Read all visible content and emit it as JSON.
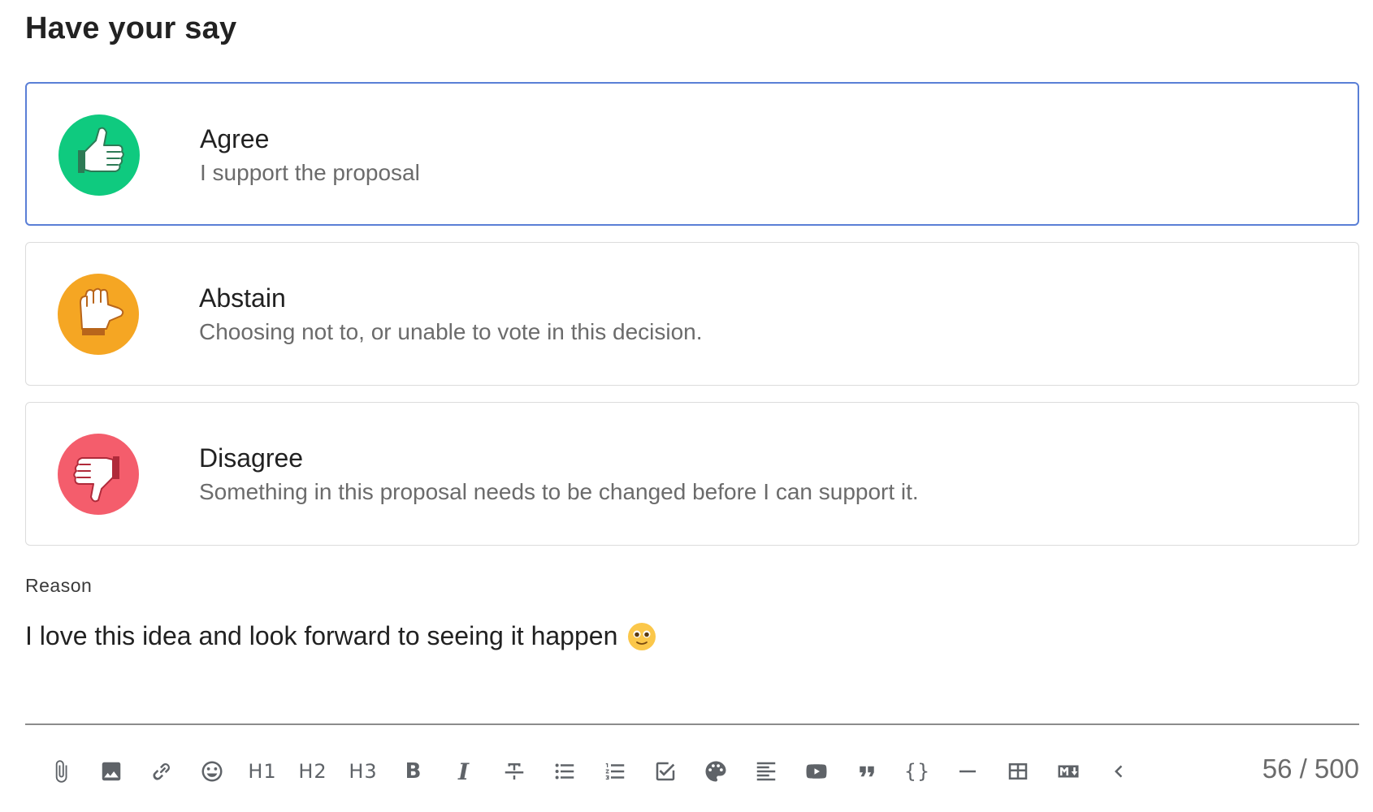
{
  "heading": "Have your say",
  "options": [
    {
      "title": "Agree",
      "description": "I support the proposal",
      "icon": "thumbs-up-icon",
      "color": "#0fca7f",
      "selected": true
    },
    {
      "title": "Abstain",
      "description": "Choosing not to, or unable to vote in this decision.",
      "icon": "hand-sideways-icon",
      "color": "#f5a623",
      "selected": false
    },
    {
      "title": "Disagree",
      "description": "Something in this proposal needs to be changed before I can support it.",
      "icon": "thumbs-down-icon",
      "color": "#f45d6c",
      "selected": false
    }
  ],
  "reason": {
    "label": "Reason",
    "text": "I love this idea and look forward to seeing it happen",
    "emoji": "smiling-face-icon"
  },
  "toolbar": {
    "items": [
      {
        "name": "attach-icon"
      },
      {
        "name": "image-icon"
      },
      {
        "name": "link-icon"
      },
      {
        "name": "emoji-icon"
      },
      {
        "name": "heading-1-button",
        "label": "H1"
      },
      {
        "name": "heading-2-button",
        "label": "H2"
      },
      {
        "name": "heading-3-button",
        "label": "H3"
      },
      {
        "name": "bold-icon",
        "label": "B"
      },
      {
        "name": "italic-icon",
        "label": "I"
      },
      {
        "name": "strikethrough-icon"
      },
      {
        "name": "bullet-list-icon"
      },
      {
        "name": "numbered-list-icon"
      },
      {
        "name": "checkbox-list-icon"
      },
      {
        "name": "palette-icon"
      },
      {
        "name": "align-icon"
      },
      {
        "name": "video-icon"
      },
      {
        "name": "quote-icon"
      },
      {
        "name": "code-block-icon",
        "label": "{}"
      },
      {
        "name": "horizontal-rule-icon"
      },
      {
        "name": "table-icon"
      },
      {
        "name": "markdown-icon"
      },
      {
        "name": "collapse-icon"
      }
    ],
    "char_count": "56 / 500"
  },
  "colors": {
    "selected_border": "#5a7fd6",
    "agree": "#0fca7f",
    "abstain": "#f5a623",
    "disagree": "#f45d6c"
  }
}
